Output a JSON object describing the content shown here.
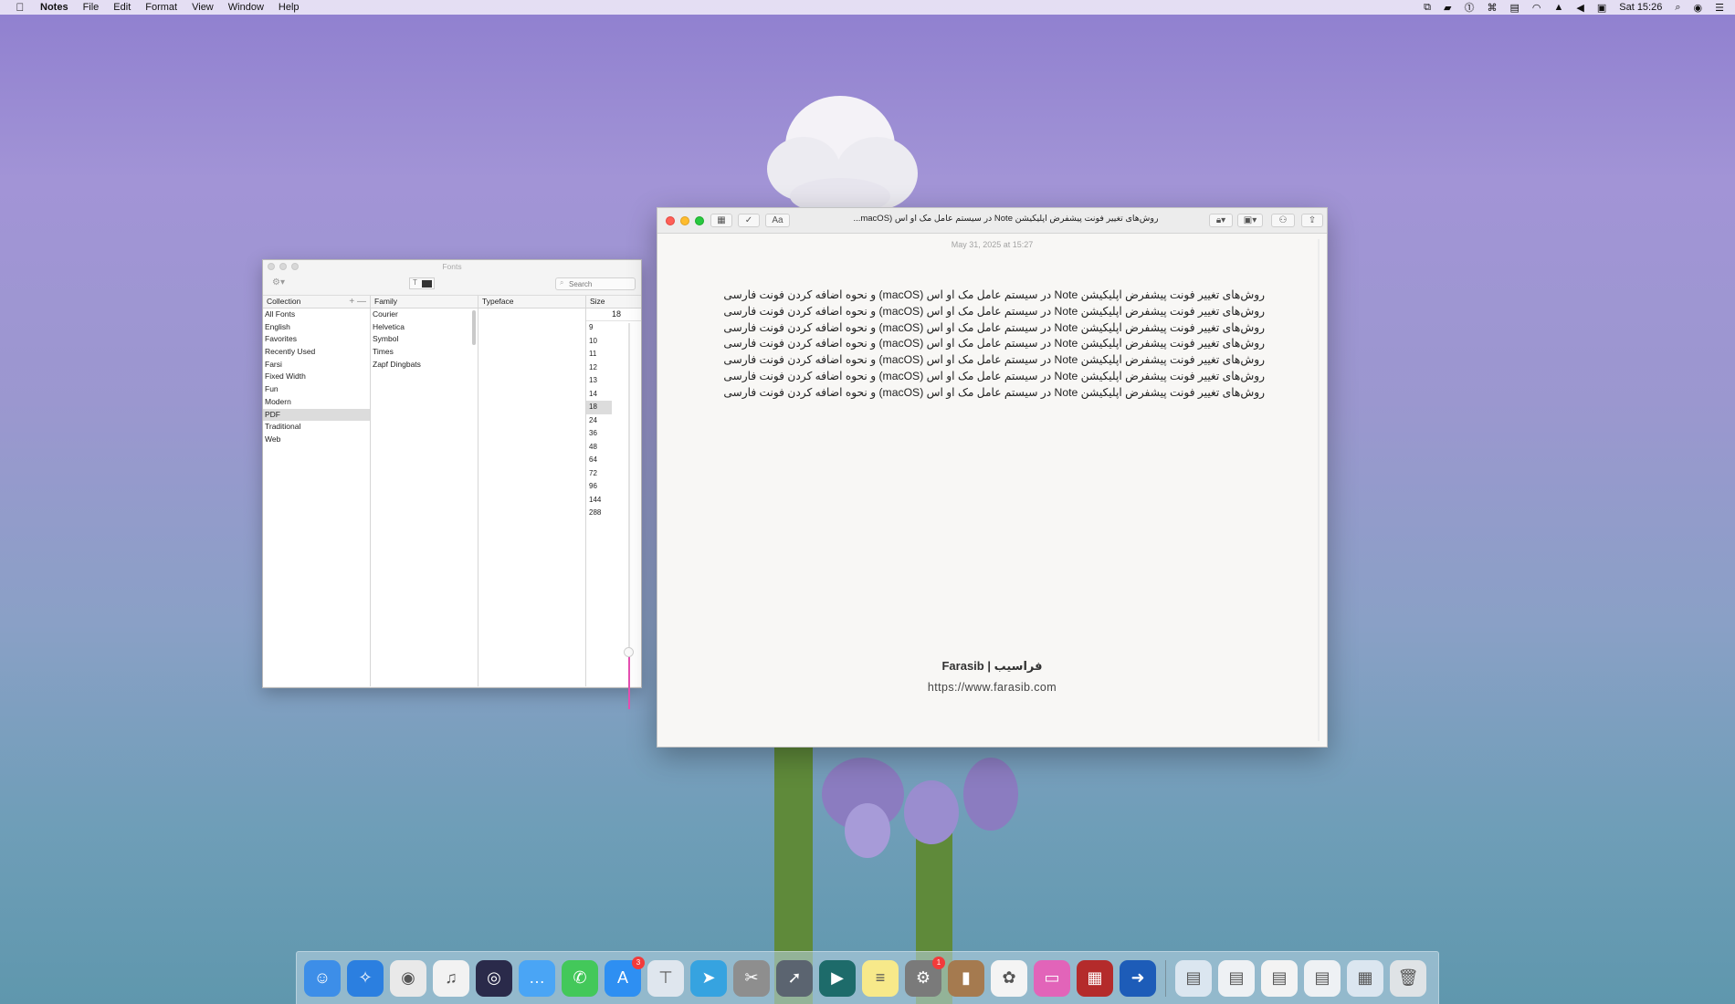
{
  "menubar": {
    "apple_icon": "apple-icon",
    "app_name": "Notes",
    "menus": [
      "File",
      "Edit",
      "Format",
      "View",
      "Window",
      "Help"
    ],
    "clock": "Sat 15:26"
  },
  "fonts_panel": {
    "title": "Fonts",
    "search_placeholder": "Search",
    "color_button_glyph": "T",
    "collection_header": "Collection",
    "family_header": "Family",
    "typeface_header": "Typeface",
    "size_header": "Size",
    "collection_add": "+",
    "collection_remove": "—",
    "collections": [
      "All Fonts",
      "English",
      "Favorites",
      "Recently Used",
      "Farsi",
      "Fixed Width",
      "Fun",
      "Modern",
      "PDF",
      "Traditional",
      "Web"
    ],
    "selected_collection": "PDF",
    "families": [
      "Courier",
      "Helvetica",
      "Symbol",
      "Times",
      "Zapf Dingbats"
    ],
    "size_value": "18",
    "sizes": [
      "9",
      "10",
      "11",
      "12",
      "13",
      "14",
      "18",
      "24",
      "36",
      "48",
      "64",
      "72",
      "96",
      "144",
      "288"
    ],
    "selected_size": "18",
    "slider_color": "#e64fb1"
  },
  "notes_window": {
    "title": "روش‌های تغییر فونت پیشفرض اپلیکیشن Note در سیستم عامل مک او اس (macOS...",
    "toolbar": {
      "table_icon": "table-icon",
      "checklist_icon": "checklist-icon",
      "format_label": "Aa",
      "lock_icon": "lock-icon",
      "media_icon": "media-icon",
      "collab_icon": "add-people-icon",
      "share_icon": "share-icon"
    },
    "date": "May 31, 2025 at 15:27",
    "lines": [
      "روش‌های تغییر فونت پیشفرض اپلیکیشن Note در سیستم عامل مک او اس (macOS) و نحوه اضافه کردن فونت فارسی",
      "روش‌های تغییر فونت پیشفرض اپلیکیشن Note در سیستم عامل مک او اس (macOS) و نحوه اضافه کردن فونت فارسی",
      "روش‌های تغییر فونت پیشفرض اپلیکیشن Note در سیستم عامل مک او اس (macOS) و نحوه اضافه کردن فونت فارسی",
      "روش‌های تغییر فونت پیشفرض اپلیکیشن Note در سیستم عامل مک او اس (macOS) و نحوه اضافه کردن فونت فارسی",
      "روش‌های تغییر فونت پیشفرض اپلیکیشن Note در سیستم عامل مک او اس (macOS) و نحوه اضافه کردن فونت فارسی",
      "روش‌های تغییر فونت پیشفرض اپلیکیشن Note در سیستم عامل مک او اس (macOS) و نحوه اضافه کردن فونت فارسی",
      "روش‌های تغییر فونت پیشفرض اپلیکیشن Note در سیستم عامل مک او اس (macOS) و نحوه اضافه کردن فونت فارسی"
    ],
    "footer_brand": "Farasib | فراسیب",
    "footer_url": "https://www.farasib.com"
  },
  "dock": {
    "apps": [
      {
        "name": "finder-icon",
        "color": "#3d8ee8",
        "glyph": "☺",
        "badge": ""
      },
      {
        "name": "safari-icon",
        "color": "#2b7fe0",
        "glyph": "✧",
        "badge": ""
      },
      {
        "name": "chrome-icon",
        "color": "#e9e9e9",
        "glyph": "◉",
        "badge": ""
      },
      {
        "name": "music-icon",
        "color": "#f2f2f2",
        "glyph": "♫",
        "badge": ""
      },
      {
        "name": "siri-icon",
        "color": "#2a2a4a",
        "glyph": "◎",
        "badge": ""
      },
      {
        "name": "messages-icon",
        "color": "#4aa5f5",
        "glyph": "…",
        "badge": ""
      },
      {
        "name": "facetime-icon",
        "color": "#43c85a",
        "glyph": "✆",
        "badge": ""
      },
      {
        "name": "app-store-icon",
        "color": "#2e8ff2",
        "glyph": "A",
        "badge": "3"
      },
      {
        "name": "keynote-icon",
        "color": "#dfe6ee",
        "glyph": "⊤",
        "badge": ""
      },
      {
        "name": "telegram-icon",
        "color": "#36a3e0",
        "glyph": "➤",
        "badge": ""
      },
      {
        "name": "archive-utility-icon",
        "color": "#8e8e8e",
        "glyph": "✂",
        "badge": ""
      },
      {
        "name": "launchpad-icon",
        "color": "#5b6470",
        "glyph": "➚",
        "badge": ""
      },
      {
        "name": "zoom-meeting-icon",
        "color": "#1d6b6a",
        "glyph": "▶",
        "badge": ""
      },
      {
        "name": "notes-icon",
        "color": "#f7e98a",
        "glyph": "≡",
        "badge": ""
      },
      {
        "name": "system-preferences-icon",
        "color": "#7a7a7a",
        "glyph": "⚙",
        "badge": "1"
      },
      {
        "name": "contacts-icon",
        "color": "#a57a4f",
        "glyph": "▮",
        "badge": ""
      },
      {
        "name": "photos-icon",
        "color": "#f4f4f4",
        "glyph": "✿",
        "badge": ""
      },
      {
        "name": "screen-sharing-icon",
        "color": "#e264b9",
        "glyph": "▭",
        "badge": ""
      },
      {
        "name": "photo-booth-icon",
        "color": "#b42b2b",
        "glyph": "▦",
        "badge": ""
      },
      {
        "name": "migration-assistant-icon",
        "color": "#1d5cb8",
        "glyph": "➜",
        "badge": ""
      }
    ],
    "documents": [
      {
        "name": "document-icon",
        "color": "#dbe6f0",
        "glyph": "▤"
      },
      {
        "name": "document-icon",
        "color": "#eef1f4",
        "glyph": "▤"
      },
      {
        "name": "document-icon",
        "color": "#f3f3f3",
        "glyph": "▤"
      },
      {
        "name": "document-icon",
        "color": "#eef1f4",
        "glyph": "▤"
      },
      {
        "name": "document-icon",
        "color": "#dbe6f0",
        "glyph": "▦"
      },
      {
        "name": "trash-icon",
        "color": "#dfe3e6",
        "glyph": "🗑"
      }
    ]
  }
}
